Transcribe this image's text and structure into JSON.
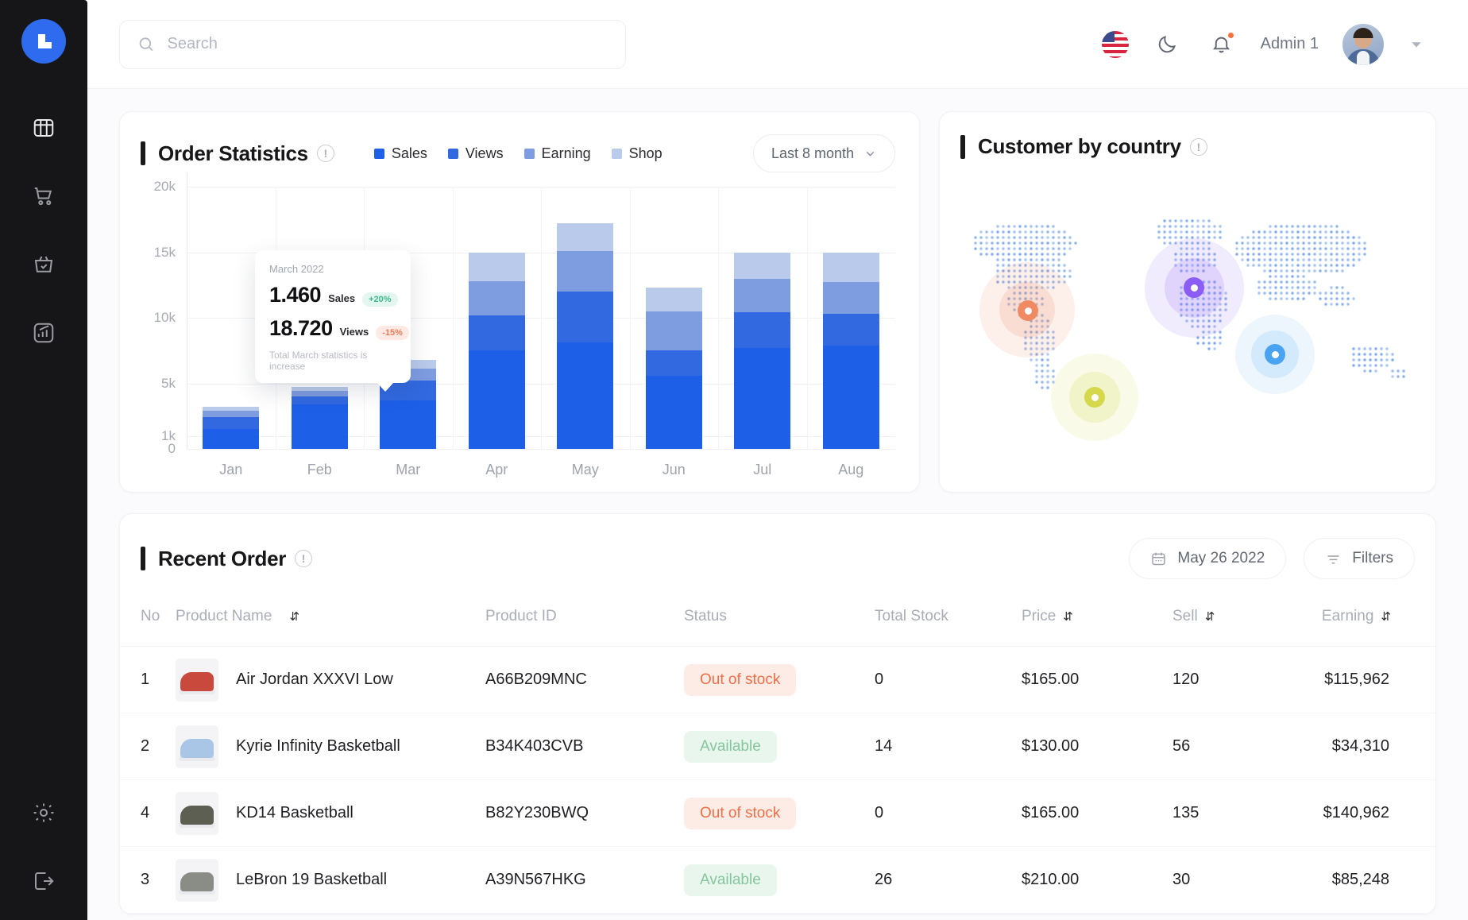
{
  "sidebar": {
    "logo_name": "brand-logo",
    "items": [
      {
        "name": "dashboard",
        "icon": "grid-box-icon"
      },
      {
        "name": "orders",
        "icon": "shopping-cart-icon"
      },
      {
        "name": "products",
        "icon": "basket-check-icon"
      },
      {
        "name": "analytics",
        "icon": "chart-growth-icon"
      }
    ],
    "bottom_items": [
      {
        "name": "settings",
        "icon": "gear-icon"
      },
      {
        "name": "logout",
        "icon": "logout-icon"
      }
    ]
  },
  "topbar": {
    "search_placeholder": "Search",
    "search_value": "",
    "language_icon": "us-flag-icon",
    "theme_icon": "moon-icon",
    "notification_icon": "bell-icon",
    "user_name": "Admin 1",
    "caret_icon": "chevron-down-icon"
  },
  "order_statistics": {
    "title": "Order Statistics",
    "info_icon": "!",
    "range_label": "Last 8 month",
    "legend": [
      {
        "label": "Sales",
        "color": "#1e5fe8"
      },
      {
        "label": "Views",
        "color": "#3269e0"
      },
      {
        "label": "Earning",
        "color": "#7e9ce0"
      },
      {
        "label": "Shop",
        "color": "#b9caea"
      }
    ],
    "tooltip": {
      "date": "March 2022",
      "rows": [
        {
          "value": "1.460",
          "label": "Sales",
          "badge": "+20%",
          "trend": "up"
        },
        {
          "value": "18.720",
          "label": "Views",
          "badge": "-15%",
          "trend": "down"
        }
      ],
      "footer": "Total March statistics is increase"
    }
  },
  "chart_data": {
    "type": "bar",
    "title": "Order Statistics",
    "stacked": true,
    "categories": [
      "Jan",
      "Feb",
      "Mar",
      "Apr",
      "May",
      "Jun",
      "Jul",
      "Aug"
    ],
    "series": [
      {
        "name": "Sales",
        "color": "#1e5fe8",
        "values": [
          1500,
          3400,
          3700,
          7500,
          8100,
          5600,
          7700,
          7900
        ]
      },
      {
        "name": "Views",
        "color": "#3269e0",
        "values": [
          900,
          600,
          1500,
          2700,
          3900,
          1900,
          2700,
          2400
        ]
      },
      {
        "name": "Earning",
        "color": "#7e9ce0",
        "values": [
          500,
          400,
          900,
          2600,
          3100,
          3000,
          2600,
          2400
        ]
      },
      {
        "name": "Shop",
        "color": "#b9caea",
        "values": [
          300,
          300,
          700,
          2200,
          2100,
          1800,
          2000,
          2300
        ]
      }
    ],
    "ytick_labels": [
      "20k",
      "15k",
      "10k",
      "5k",
      "1k",
      "0"
    ],
    "ytick_values": [
      20000,
      15000,
      10000,
      5000,
      1000,
      0
    ],
    "ylim": [
      0,
      20000
    ],
    "xlabel": "",
    "ylabel": "",
    "grid": true,
    "legend_position": "top"
  },
  "customer_by_country": {
    "title": "Customer by country",
    "info_icon": "!",
    "markers": [
      {
        "name": "north-america",
        "color": "#f08a63",
        "glow": "rgba(240,138,99,0.16)"
      },
      {
        "name": "europe",
        "color": "#8b5cf6",
        "glow": "rgba(139,92,246,0.15)"
      },
      {
        "name": "africa",
        "color": "#d4d84a",
        "glow": "rgba(212,216,74,0.18)"
      },
      {
        "name": "asia-pacific",
        "color": "#4aa3f0",
        "glow": "rgba(74,163,240,0.15)"
      }
    ]
  },
  "recent_order": {
    "title": "Recent Order",
    "info_icon": "!",
    "date_label": "May 26 2022",
    "date_icon": "calendar-icon",
    "filters_label": "Filters",
    "filters_icon": "filter-icon",
    "sort_icon": "⇵",
    "columns": [
      {
        "key": "no",
        "label": "No",
        "sortable": false
      },
      {
        "key": "name",
        "label": "Product Name",
        "sortable": true
      },
      {
        "key": "pid",
        "label": "Product ID",
        "sortable": false
      },
      {
        "key": "status",
        "label": "Status",
        "sortable": false
      },
      {
        "key": "stock",
        "label": "Total Stock",
        "sortable": false
      },
      {
        "key": "price",
        "label": "Price",
        "sortable": true
      },
      {
        "key": "sell",
        "label": "Sell",
        "sortable": true
      },
      {
        "key": "earning",
        "label": "Earning",
        "sortable": true
      }
    ],
    "rows": [
      {
        "no": "1",
        "name": "Air Jordan XXXVI Low",
        "pid": "A66B209MNC",
        "status": "Out of stock",
        "status_type": "out",
        "stock": "0",
        "price": "$165.00",
        "sell": "120",
        "earning": "$115,962",
        "shoe_color": "#c94a3c"
      },
      {
        "no": "2",
        "name": "Kyrie Infinity Basketball",
        "pid": "B34K403CVB",
        "status": "Available",
        "status_type": "ok",
        "stock": "14",
        "price": "$130.00",
        "sell": "56",
        "earning": "$34,310",
        "shoe_color": "#a9c6e6"
      },
      {
        "no": "4",
        "name": "KD14 Basketball",
        "pid": "B82Y230BWQ",
        "status": "Out of stock",
        "status_type": "out",
        "stock": "0",
        "price": "$165.00",
        "sell": "135",
        "earning": "$140,962",
        "shoe_color": "#5c5f52"
      },
      {
        "no": "3",
        "name": "LeBron 19 Basketball",
        "pid": "A39N567HKG",
        "status": "Available",
        "status_type": "ok",
        "stock": "26",
        "price": "$210.00",
        "sell": "30",
        "earning": "$85,248",
        "shoe_color": "#8a8d86"
      }
    ]
  }
}
